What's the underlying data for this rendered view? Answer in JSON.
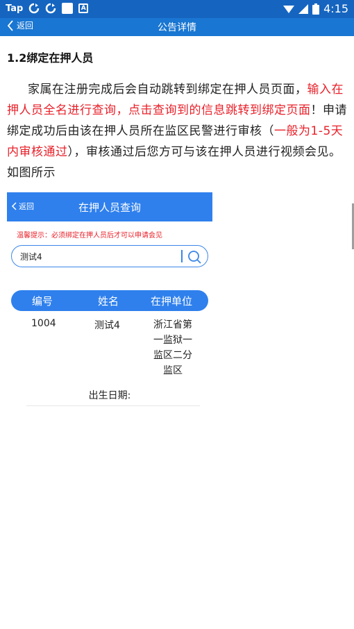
{
  "status_bar": {
    "carrier": "Tap",
    "time": "4:15",
    "icons": [
      "sync-icon",
      "sync-icon",
      "square-icon",
      "a-icon",
      "wifi-icon",
      "signal-icon",
      "battery-icon"
    ]
  },
  "navbar": {
    "back_label": "返回",
    "title": "公告详情"
  },
  "document": {
    "heading": "1.2绑定在押人员",
    "para_part1": "家属在注册完成后会自动跳转到绑定在押人员页面，",
    "para_red1": "输入在押人员全名进行查询，点击查询到的信息跳转到绑定页面",
    "para_part2": "！申请绑定成功后由该在押人员所在监区民警进行审核（",
    "para_red2": "一般为1-5天内审核通过",
    "para_part3": "），审核通过后您方可与该在押人员进行视频会见。如图所示"
  },
  "embedded_screenshot": {
    "back_label": "返回",
    "title": "在押人员查询",
    "tip": "温馨提示：必须绑定在押人员后才可以申请会见",
    "search_value": "测试4",
    "table": {
      "headers": [
        "编号",
        "姓名",
        "在押单位"
      ],
      "row": {
        "id": "1004",
        "name": "测试4",
        "unit": "浙江省第一监狱一监区二分监区"
      }
    },
    "dob_label": "出生日期:"
  },
  "colors": {
    "status_bar": "#1565c0",
    "nav_bar": "#1976d2",
    "accent": "#2f80ed",
    "highlight_red": "#e8212a"
  }
}
